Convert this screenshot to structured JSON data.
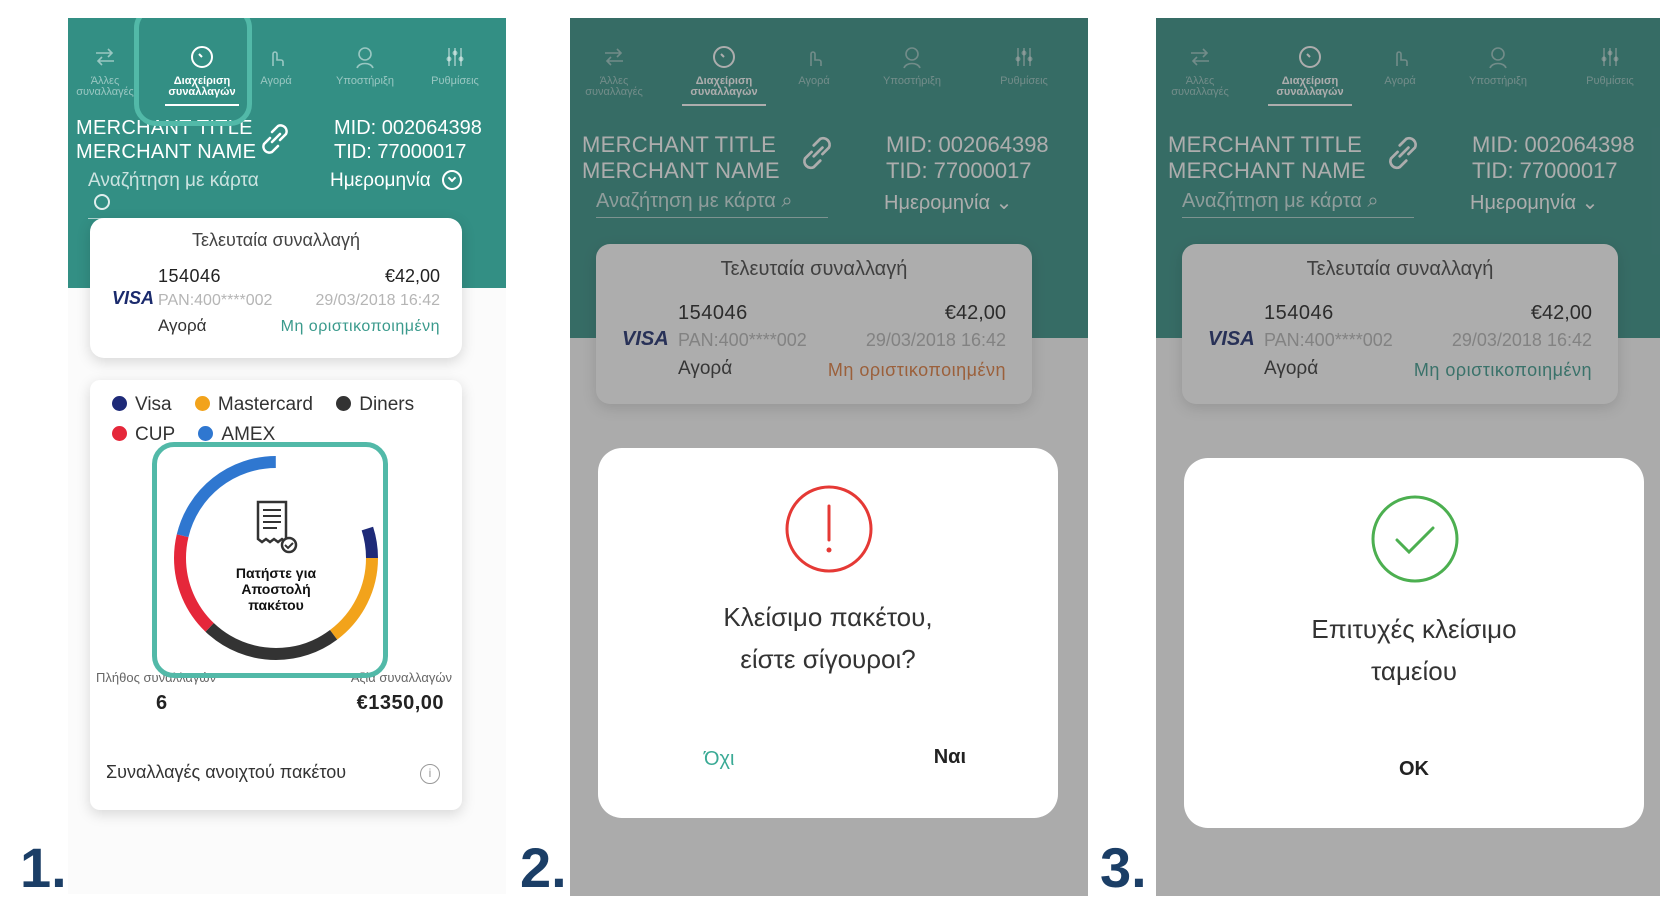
{
  "steps": [
    "1.",
    "2.",
    "3."
  ],
  "colors": {
    "teal": "#338f84",
    "highlight": "#52b9a8",
    "status_green": "#3a9a8c",
    "status_orange": "#e07b3c",
    "error_red": "#e53935",
    "success_green": "#4caf50",
    "step_blue": "#1b3e66"
  },
  "tabs": [
    {
      "label": "Άλλες συναλλαγές",
      "icon": "swap-icon"
    },
    {
      "label": "Διαχείριση συναλλαγών",
      "icon": "clock-icon"
    },
    {
      "label": "Αγορά",
      "icon": "touch-icon"
    },
    {
      "label": "Υποστήριξη",
      "icon": "support-icon"
    },
    {
      "label": "Ρυθμίσεις",
      "icon": "settings-icon"
    }
  ],
  "merchant": {
    "title": "MERCHANT TITLE",
    "name": "MERCHANT NAME",
    "mid": "MID: 002064398",
    "tid": "TID: 77000017",
    "link_icon": "link-icon"
  },
  "search": {
    "placeholder": "Αναζήτηση με κάρτα",
    "date_filter": "Ημερομηνία"
  },
  "last_tx": {
    "title": "Τελευταία συναλλαγή",
    "id": "154046",
    "amount": "€42,00",
    "card_brand": "VISA",
    "pan": "PAN:400****002",
    "datetime": "29/03/2018 16:42",
    "type": "Αγορά",
    "status": "Μη οριστικοποιημένη"
  },
  "legend": [
    {
      "label": "Visa",
      "color": "#1e2a78"
    },
    {
      "label": "Mastercard",
      "color": "#f2a31b"
    },
    {
      "label": "Diners",
      "color": "#333333"
    },
    {
      "label": "CUP",
      "color": "#e5273a"
    },
    {
      "label": "AMEX",
      "color": "#2f77d0"
    }
  ],
  "donut": {
    "center_text_1": "Πατήστε για",
    "center_text_2": "Αποστολή",
    "center_text_3": "πακέτου",
    "icon": "receipt-check-icon"
  },
  "stats": {
    "count_label": "Πλήθος συναλλαγών",
    "count": "6",
    "value_label": "Αξία συναλλαγών",
    "value": "€1350,00"
  },
  "open_batch": {
    "label": "Συναλλαγές ανοιχτού πακέτου",
    "icon": "info-icon"
  },
  "confirm_dialog": {
    "line1": "Κλείσιμο πακέτου,",
    "line2": "είστε σίγουροι?",
    "no": "Όχι",
    "yes": "Ναι",
    "icon": "exclamation-circle-icon"
  },
  "success_dialog": {
    "line1": "Επιτυχές κλείσιμο",
    "line2": "ταμείου",
    "ok": "OK",
    "icon": "check-circle-icon"
  }
}
